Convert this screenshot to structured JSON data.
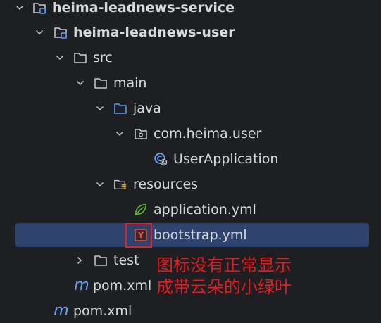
{
  "tree": {
    "items": [
      {
        "label": "heima-leadnews-service",
        "icon": "module-folder-icon"
      },
      {
        "label": "heima-leadnews-user",
        "icon": "module-folder-icon"
      },
      {
        "label": "src",
        "icon": "folder-icon"
      },
      {
        "label": "main",
        "icon": "folder-icon"
      },
      {
        "label": "java",
        "icon": "source-folder-icon"
      },
      {
        "label": "com.heima.user",
        "icon": "package-icon"
      },
      {
        "label": "UserApplication",
        "icon": "spring-boot-class-icon"
      },
      {
        "label": "resources",
        "icon": "resources-folder-icon"
      },
      {
        "label": "application.yml",
        "icon": "spring-leaf-icon"
      },
      {
        "label": "bootstrap.yml",
        "icon": "yaml-file-icon",
        "icon_text": "Y"
      },
      {
        "label": "test",
        "icon": "folder-icon"
      },
      {
        "label": "pom.xml",
        "icon": "maven-icon",
        "icon_text": "m"
      },
      {
        "label": "pom.xml",
        "icon": "maven-icon",
        "icon_text": "m"
      }
    ]
  },
  "annotation": {
    "line1": "图标没有正常显示",
    "line2": "成带云朵的小绿叶",
    "color": "#e11d23"
  },
  "colors": {
    "background": "#1e1f22",
    "selection": "#2e436e",
    "text": "#d7d9de",
    "folder_stroke": "#c9ccd3",
    "source_folder": "#5d9cf5",
    "spring_green": "#5fb832",
    "yaml_red": "#e5504e",
    "maven_blue": "#6ea6f7"
  }
}
